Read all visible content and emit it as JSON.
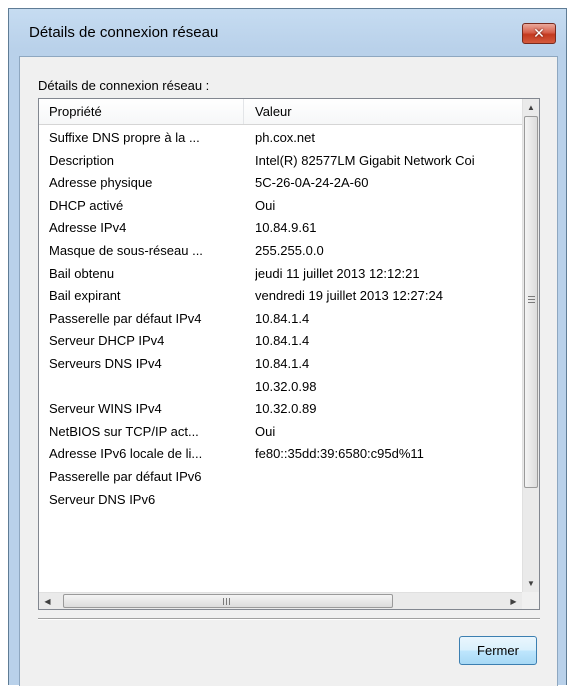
{
  "window": {
    "title": "Détails de connexion réseau",
    "close_glyph": "✕"
  },
  "section_label": "Détails de connexion réseau :",
  "table": {
    "columns": [
      "Propriété",
      "Valeur"
    ],
    "rows": [
      {
        "property": "Suffixe DNS propre à la ...",
        "value": "ph.cox.net"
      },
      {
        "property": "Description",
        "value": "Intel(R) 82577LM Gigabit Network Coi"
      },
      {
        "property": "Adresse physique",
        "value": "5C-26-0A-24-2A-60"
      },
      {
        "property": "DHCP activé",
        "value": "Oui"
      },
      {
        "property": "Adresse IPv4",
        "value": "10.84.9.61"
      },
      {
        "property": "Masque de sous-réseau ...",
        "value": "255.255.0.0"
      },
      {
        "property": "Bail obtenu",
        "value": "jeudi 11 juillet 2013 12:12:21"
      },
      {
        "property": "Bail expirant",
        "value": "vendredi 19 juillet 2013 12:27:24"
      },
      {
        "property": "Passerelle par défaut IPv4",
        "value": "10.84.1.4"
      },
      {
        "property": "Serveur DHCP IPv4",
        "value": "10.84.1.4"
      },
      {
        "property": "Serveurs DNS IPv4",
        "value": "10.84.1.4"
      },
      {
        "property": "",
        "value": "10.32.0.98"
      },
      {
        "property": "Serveur WINS IPv4",
        "value": "10.32.0.89"
      },
      {
        "property": "NetBIOS sur TCP/IP act...",
        "value": "Oui"
      },
      {
        "property": "Adresse IPv6 locale de li...",
        "value": "fe80::35dd:39:6580:c95d%11"
      },
      {
        "property": "Passerelle par défaut IPv6",
        "value": ""
      },
      {
        "property": "Serveur DNS IPv6",
        "value": ""
      }
    ]
  },
  "scroll": {
    "up_glyph": "▲",
    "down_glyph": "▼",
    "left_glyph": "◀",
    "right_glyph": "▶"
  },
  "buttons": {
    "close_label": "Fermer"
  },
  "colors": {
    "frame": "#b9d1ea",
    "client": "#f0f0f0",
    "close_button": "#c3391f",
    "button_border": "#3c7fb1"
  }
}
